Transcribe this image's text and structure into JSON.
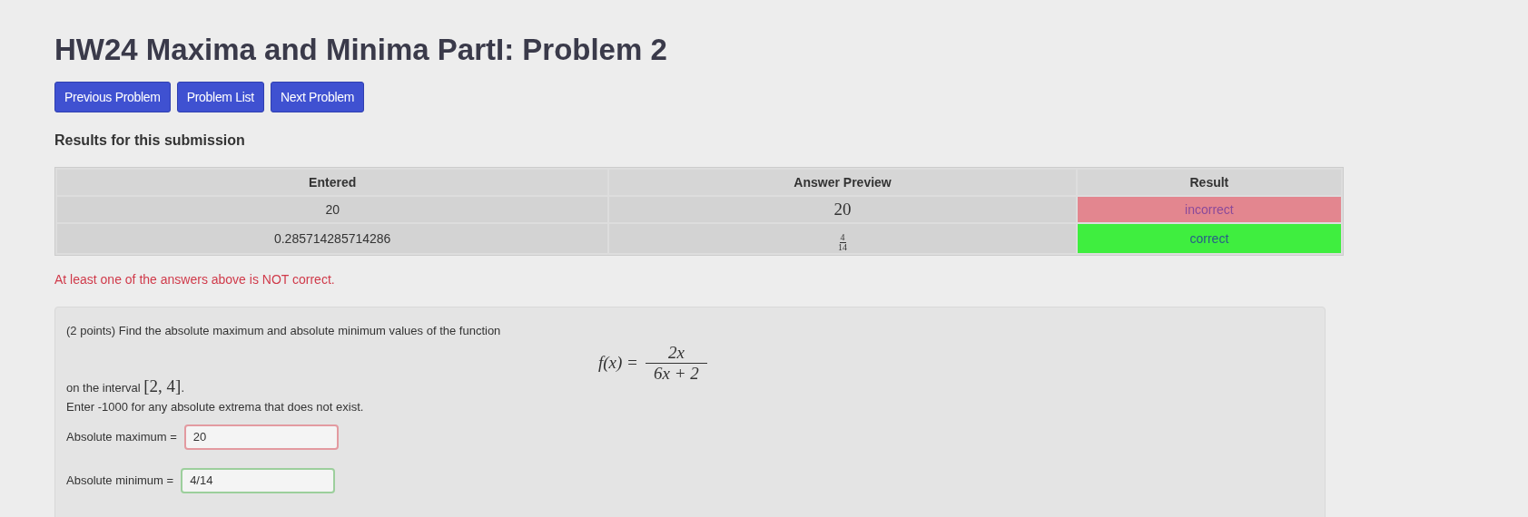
{
  "title": "HW24 Maxima and Minima PartI: Problem 2",
  "nav_buttons": [
    "Previous Problem",
    "Problem List",
    "Next Problem"
  ],
  "results": {
    "heading": "Results for this submission",
    "columns": [
      "Entered",
      "Answer Preview",
      "Result"
    ],
    "rows": [
      {
        "entered": "20",
        "preview": {
          "kind": "text",
          "text": "20"
        },
        "result": "incorrect",
        "correct": false
      },
      {
        "entered": "0.285714285714286",
        "preview": {
          "kind": "fraction",
          "numerator": "4",
          "denominator": "14"
        },
        "result": "correct",
        "correct": true
      }
    ],
    "message": "At least one of the answers above is NOT correct."
  },
  "problem": {
    "intro": "(2 points) Find the absolute maximum and absolute minimum values of the function",
    "formula": {
      "lhs": "f(x) =",
      "numerator": "2x",
      "denominator": "6x + 2"
    },
    "interval_prefix": "on the interval",
    "interval": "[2, 4]",
    "interval_suffix": ".",
    "instruction": "Enter -1000 for any absolute extrema that does not exist.",
    "answers": [
      {
        "label": "Absolute maximum =",
        "value": "20",
        "correct": false
      },
      {
        "label": "Absolute minimum =",
        "value": "4/14",
        "correct": true
      }
    ]
  }
}
